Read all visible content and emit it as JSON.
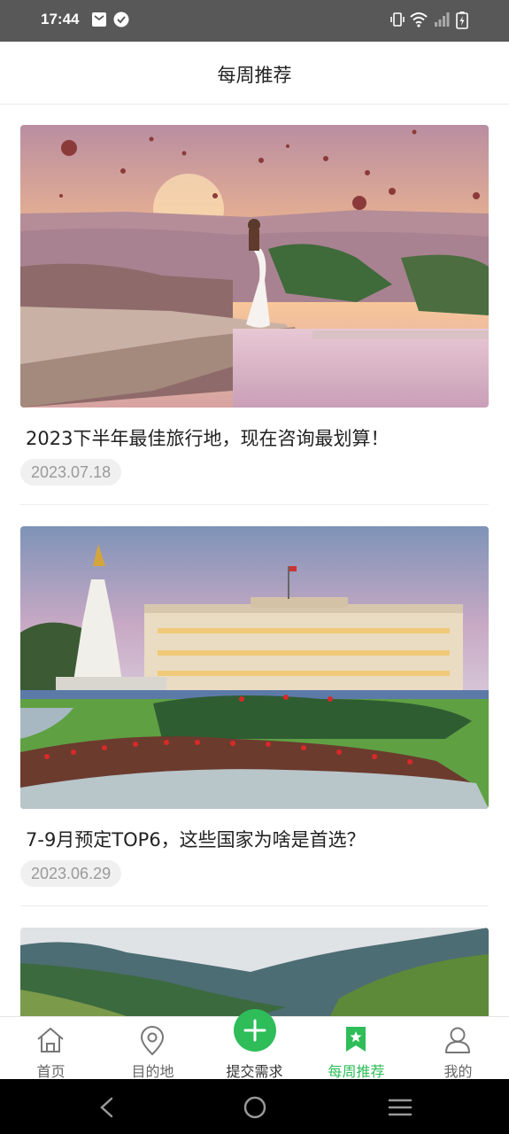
{
  "status": {
    "time": "17:44"
  },
  "header": {
    "title": "每周推荐"
  },
  "articles": [
    {
      "title": "2023下半年最佳旅行地，现在咨询最划算！",
      "date": "2023.07.18"
    },
    {
      "title": "7-9月预定TOP6，这些国家为啥是首选？",
      "date": "2023.06.29"
    }
  ],
  "tabs": [
    {
      "label": "首页",
      "icon": "home-icon"
    },
    {
      "label": "目的地",
      "icon": "location-pin-icon"
    },
    {
      "label": "提交需求",
      "icon": "plus-icon"
    },
    {
      "label": "每周推荐",
      "icon": "bookmark-star-icon"
    },
    {
      "label": "我的",
      "icon": "user-icon"
    }
  ],
  "active_tab": "每周推荐",
  "colors": {
    "accent": "#2ebd59",
    "statusbar": "#585858"
  }
}
